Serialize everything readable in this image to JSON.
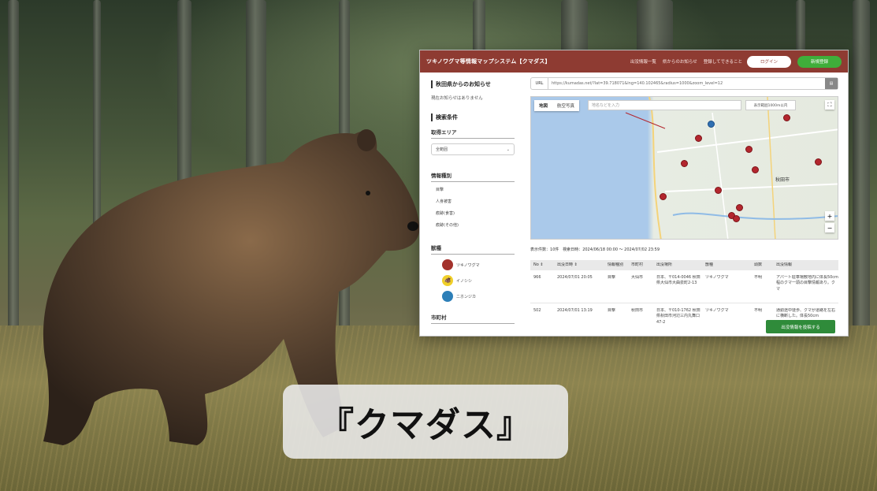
{
  "header": {
    "title": "ツキノワグマ等情報マップシステム【クマダス】",
    "nav": [
      "出没情報一覧",
      "県からのお知らせ",
      "登録してできること"
    ],
    "login_label": "ログイン",
    "register_label": "新規登録"
  },
  "sidebar": {
    "notice_title": "秋田県からのお知らせ",
    "notice_text": "現在お知らせはありません",
    "search_title": "検索条件",
    "area_label": "取得エリア",
    "area_value": "全範囲",
    "type_label": "情報種別",
    "types": [
      "目撃",
      "人身被害",
      "痕跡(食害)",
      "痕跡(その他)"
    ],
    "animal_label": "獣種",
    "animals": [
      {
        "name": "ツキノワグマ",
        "color": "#a3322c"
      },
      {
        "name": "イノシシ",
        "color": "#f0cf2a"
      },
      {
        "name": "ニホンジカ",
        "color": "#2d7fb8"
      }
    ],
    "city_label": "市町村"
  },
  "url": {
    "label": "URL",
    "value": "https://kumadas.net/?lat=39.718071&lng=140.102465&radius=1000&zoom_level=12"
  },
  "map": {
    "tab_map": "地図",
    "tab_aerial": "航空写真",
    "search_placeholder": "地名などを入力",
    "chip": "表示範囲1000m以内",
    "city": "秋田市",
    "fullscreen": "⛶",
    "zoom_in": "+",
    "zoom_out": "−"
  },
  "results": {
    "count_label": "表示件数：",
    "count": "10件",
    "period_label": "検索日時：",
    "period": "2024/06/18 00:00 〜 2024/07/02 23:59"
  },
  "table": {
    "headers": [
      "No ⇕",
      "出没日時 ⇕",
      "情報種別",
      "市町村",
      "出没場所",
      "獣種",
      "頭数",
      "出没情報"
    ],
    "rows": [
      {
        "no": "966",
        "date": "2024/07/01 20:05",
        "type": "目撃",
        "city": "大仙市",
        "place": "日本、〒014-0046 秋田県大仙市大曲泉町2-13",
        "animal": "ツキノワグマ",
        "count": "不明",
        "info": "アパート駐車場敷地内に体長50cm程のクマ一頭の目撃情報あり。クマ"
      },
      {
        "no": "502",
        "date": "2024/07/01 13:19",
        "type": "目撃",
        "city": "秋田市",
        "place": "日本、〒010-1762 秋田県秋田市河辺三内丸舞口47-2",
        "animal": "ツキノワグマ",
        "count": "不明",
        "info": "通勤途中徒歩、クマが道路を左右に横断した。体長50cm"
      }
    ]
  },
  "post_button": "出没情報を投稿する",
  "caption": "『クマダス』"
}
